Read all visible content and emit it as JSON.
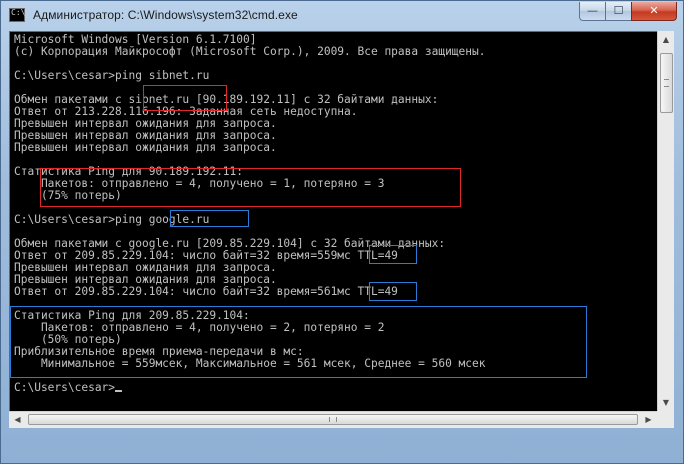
{
  "window": {
    "title": "Администратор: C:\\Windows\\system32\\cmd.exe",
    "icon": "cmd-icon",
    "controls": {
      "minimize": "—",
      "maximize": "☐",
      "close": "✕"
    }
  },
  "console": {
    "lines": [
      "Microsoft Windows [Version 6.1.7100]",
      "(c) Корпорация Майкрософт (Microsoft Corp.), 2009. Все права защищены.",
      "",
      "C:\\Users\\cesar>ping sibnet.ru",
      "",
      "Обмен пакетами с sibnet.ru [90.189.192.11] с 32 байтами данных:",
      "Ответ от 213.228.116.196: Заданная сеть недоступна.",
      "Превышен интервал ожидания для запроса.",
      "Превышен интервал ожидания для запроса.",
      "Превышен интервал ожидания для запроса.",
      "",
      "Статистика Ping для 90.189.192.11:",
      "    Пакетов: отправлено = 4, получено = 1, потеряно = 3",
      "    (75% потерь)",
      "",
      "C:\\Users\\cesar>ping google.ru",
      "",
      "Обмен пакетами с google.ru [209.85.229.104] с 32 байтами данных:",
      "Ответ от 209.85.229.104: число байт=32 время=559мс TTL=49",
      "Превышен интервал ожидания для запроса.",
      "Превышен интервал ожидания для запроса.",
      "Ответ от 209.85.229.104: число байт=32 время=561мс TTL=49",
      "",
      "Статистика Ping для 209.85.229.104:",
      "    Пакетов: отправлено = 4, получено = 2, потеряно = 2",
      "    (50% потерь)",
      "Приблизительное время приема-передачи в мс:",
      "    Минимальное = 559мсек, Максимальное = 561 мсек, Среднее = 560 мсек",
      "",
      "C:\\Users\\cesar>"
    ]
  },
  "colors": {
    "console_bg": "#000000",
    "console_fg": "#c0c0c0",
    "highlight_red": "#e0282a",
    "highlight_blue": "#2a7bd6"
  }
}
